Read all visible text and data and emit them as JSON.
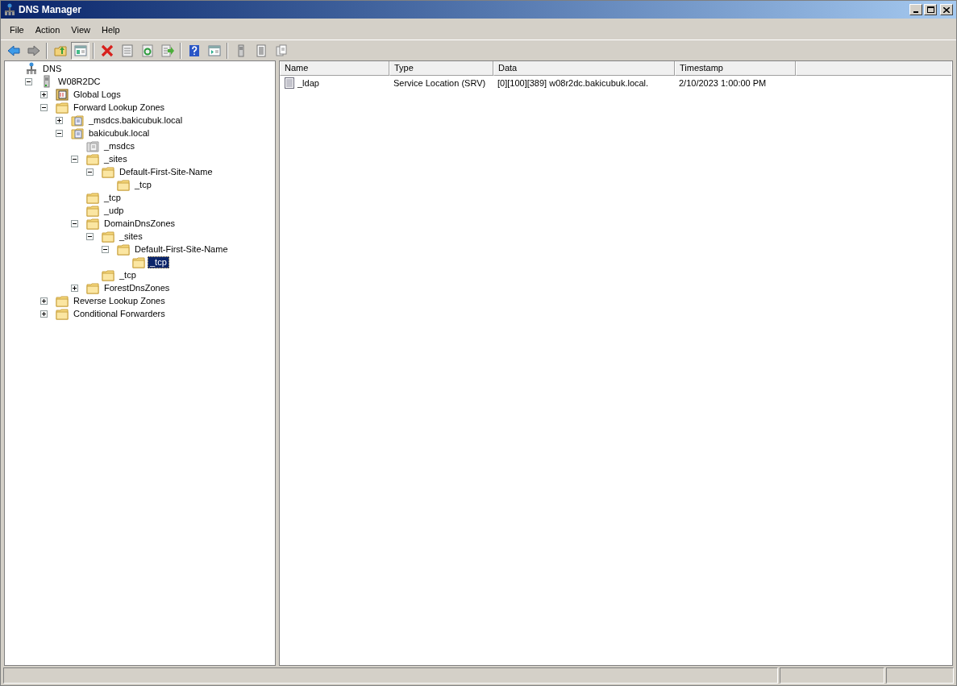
{
  "window": {
    "title": "DNS Manager"
  },
  "menu": [
    "File",
    "Action",
    "View",
    "Help"
  ],
  "toolbar_buttons": [
    {
      "pressed": false
    },
    {
      "pressed": false
    },
    {
      "pressed": false
    },
    {
      "pressed": true
    },
    {
      "pressed": false
    },
    {
      "pressed": false
    },
    {
      "pressed": false
    },
    {
      "pressed": false
    },
    {
      "pressed": false
    },
    {
      "pressed": false
    },
    {
      "pressed": false
    },
    {
      "pressed": false
    },
    {
      "pressed": false
    }
  ],
  "tree": [
    {
      "label": "DNS",
      "kind": "dns",
      "selected": false,
      "children": [
        {
          "label": "W08R2DC",
          "kind": "server",
          "expanded": true,
          "selected": false,
          "children": [
            {
              "label": "Global Logs",
              "kind": "log",
              "expanded": false,
              "selected": false
            },
            {
              "label": "Forward Lookup Zones",
              "kind": "folder",
              "expanded": true,
              "selected": false,
              "children": [
                {
                  "label": "_msdcs.bakicubuk.local",
                  "kind": "zone",
                  "expanded": false,
                  "selected": false
                },
                {
                  "label": "bakicubuk.local",
                  "kind": "zone",
                  "expanded": true,
                  "selected": false,
                  "children": [
                    {
                      "label": "_msdcs",
                      "kind": "delegation",
                      "selected": false
                    },
                    {
                      "label": "_sites",
                      "kind": "folder",
                      "expanded": true,
                      "selected": false,
                      "children": [
                        {
                          "label": "Default-First-Site-Name",
                          "kind": "folder",
                          "expanded": true,
                          "selected": false,
                          "children": [
                            {
                              "label": "_tcp",
                              "kind": "folder",
                              "selected": false
                            }
                          ]
                        }
                      ]
                    },
                    {
                      "label": "_tcp",
                      "kind": "folder",
                      "selected": false
                    },
                    {
                      "label": "_udp",
                      "kind": "folder",
                      "selected": false
                    },
                    {
                      "label": "DomainDnsZones",
                      "kind": "folder",
                      "expanded": true,
                      "selected": false,
                      "children": [
                        {
                          "label": "_sites",
                          "kind": "folder",
                          "expanded": true,
                          "selected": false,
                          "children": [
                            {
                              "label": "Default-First-Site-Name",
                              "kind": "folder",
                              "expanded": true,
                              "selected": false,
                              "children": [
                                {
                                  "label": "_tcp",
                                  "kind": "folder",
                                  "selected": true
                                }
                              ]
                            }
                          ]
                        },
                        {
                          "label": "_tcp",
                          "kind": "folder",
                          "selected": false
                        }
                      ]
                    },
                    {
                      "label": "ForestDnsZones",
                      "kind": "folder",
                      "expanded": false,
                      "selected": false
                    }
                  ]
                }
              ]
            },
            {
              "label": "Reverse Lookup Zones",
              "kind": "folder",
              "expanded": false,
              "selected": false
            },
            {
              "label": "Conditional Forwarders",
              "kind": "folder",
              "expanded": false,
              "selected": false
            }
          ]
        }
      ]
    }
  ],
  "table": {
    "columns": [
      "Name",
      "Type",
      "Data",
      "Timestamp"
    ],
    "rows": [
      {
        "cells": [
          "_ldap",
          "Service Location (SRV)",
          "[0][100][389] w08r2dc.bakicubuk.local.",
          "2/10/2023 1:00:00 PM"
        ],
        "selected": false
      }
    ]
  }
}
